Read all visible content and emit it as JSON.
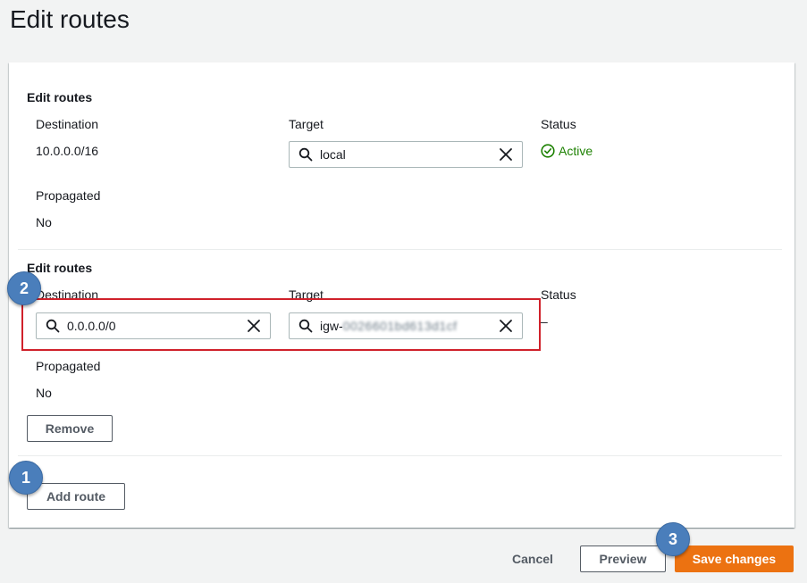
{
  "page": {
    "title": "Edit routes"
  },
  "routes": [
    {
      "section_title": "Edit routes",
      "destination_label": "Destination",
      "destination_value": "10.0.0.0/16",
      "target_label": "Target",
      "target_value": "local",
      "status_label": "Status",
      "status_value": "Active",
      "propagated_label": "Propagated",
      "propagated_value": "No"
    },
    {
      "section_title": "Edit routes",
      "destination_label": "Destination",
      "destination_value": "0.0.0.0/0",
      "target_label": "Target",
      "target_prefix": "igw-",
      "target_obscured": "0026601bd613d1cf",
      "status_label": "Status",
      "status_value": "–",
      "propagated_label": "Propagated",
      "propagated_value": "No",
      "remove_label": "Remove"
    }
  ],
  "add_route_label": "Add route",
  "footer": {
    "cancel_label": "Cancel",
    "preview_label": "Preview",
    "save_label": "Save changes"
  },
  "annotations": {
    "badge_1": "1",
    "badge_2": "2",
    "badge_3": "3"
  },
  "colors": {
    "primary": "#ec7211",
    "success": "#1d8102",
    "highlight": "#d0212b",
    "badge": "#4a7ebb"
  },
  "icons": {
    "search": "search-icon",
    "clear": "close-icon",
    "status": "check-circle-icon"
  }
}
